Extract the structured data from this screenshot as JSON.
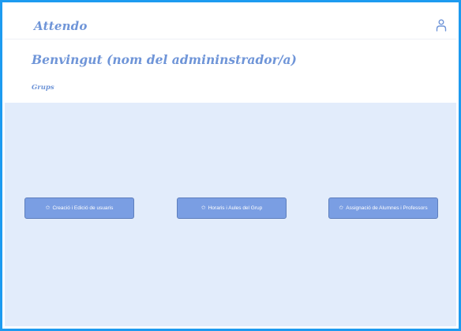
{
  "app": {
    "title": "Attendo"
  },
  "header": {
    "user_icon": "user-icon"
  },
  "main": {
    "welcome": "Benvingut (nom del admininstrador/a)",
    "section": "Grups"
  },
  "actions": [
    {
      "icon": "star-icon",
      "glyph": "✩",
      "label": "Creació i Edició de usuaris"
    },
    {
      "icon": "star-icon",
      "glyph": "✩",
      "label": "Horaris i Aules del Grup"
    },
    {
      "icon": "star-icon",
      "glyph": "✩",
      "label": "Assignació de Alumnes i Professors"
    }
  ],
  "colors": {
    "accent": "#6f95d8",
    "button": "#7a9ee3",
    "content_bg": "#e2ecfb",
    "frame_border": "#1d9bf0"
  }
}
